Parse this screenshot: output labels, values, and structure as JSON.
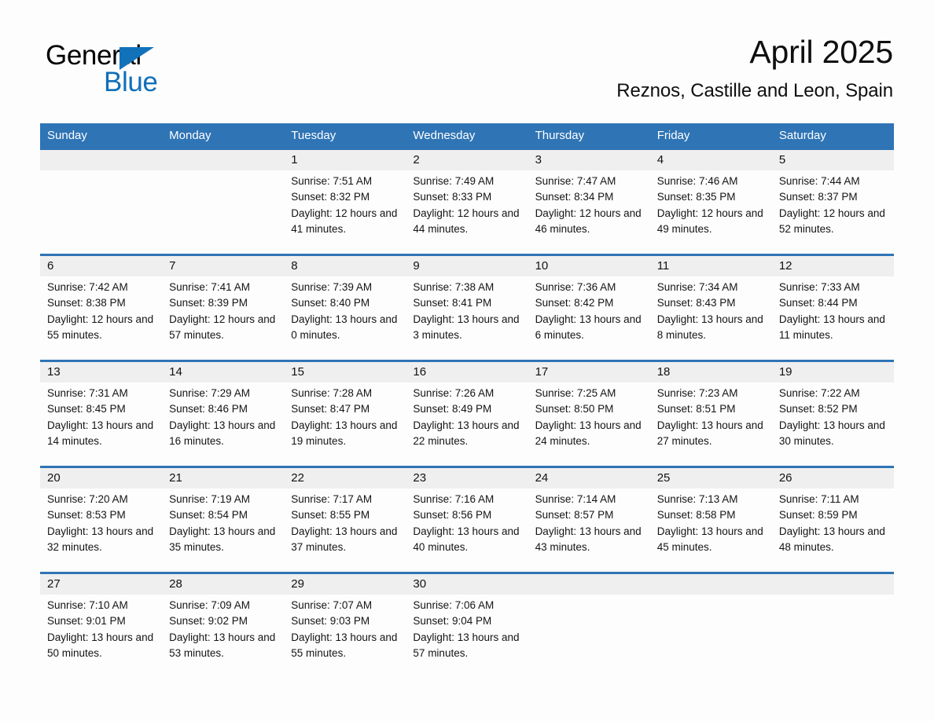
{
  "brand": {
    "word_one": "General",
    "word_two": "Blue",
    "triangle_icon": "triangle-icon",
    "accent_color": "#0f6fb8"
  },
  "header": {
    "month_title": "April 2025",
    "location": "Reznos, Castille and Leon, Spain"
  },
  "colors": {
    "header_blue": "#2f74b5",
    "date_band_gray": "#efefef",
    "page_background": "#fdfdfd",
    "text": "#141414"
  },
  "calendar": {
    "weekdays": [
      "Sunday",
      "Monday",
      "Tuesday",
      "Wednesday",
      "Thursday",
      "Friday",
      "Saturday"
    ],
    "weeks": [
      [
        {
          "day": "",
          "sunrise": "",
          "sunset": "",
          "daylight": ""
        },
        {
          "day": "",
          "sunrise": "",
          "sunset": "",
          "daylight": ""
        },
        {
          "day": "1",
          "sunrise": "Sunrise: 7:51 AM",
          "sunset": "Sunset: 8:32 PM",
          "daylight": "Daylight: 12 hours and 41 minutes."
        },
        {
          "day": "2",
          "sunrise": "Sunrise: 7:49 AM",
          "sunset": "Sunset: 8:33 PM",
          "daylight": "Daylight: 12 hours and 44 minutes."
        },
        {
          "day": "3",
          "sunrise": "Sunrise: 7:47 AM",
          "sunset": "Sunset: 8:34 PM",
          "daylight": "Daylight: 12 hours and 46 minutes."
        },
        {
          "day": "4",
          "sunrise": "Sunrise: 7:46 AM",
          "sunset": "Sunset: 8:35 PM",
          "daylight": "Daylight: 12 hours and 49 minutes."
        },
        {
          "day": "5",
          "sunrise": "Sunrise: 7:44 AM",
          "sunset": "Sunset: 8:37 PM",
          "daylight": "Daylight: 12 hours and 52 minutes."
        }
      ],
      [
        {
          "day": "6",
          "sunrise": "Sunrise: 7:42 AM",
          "sunset": "Sunset: 8:38 PM",
          "daylight": "Daylight: 12 hours and 55 minutes."
        },
        {
          "day": "7",
          "sunrise": "Sunrise: 7:41 AM",
          "sunset": "Sunset: 8:39 PM",
          "daylight": "Daylight: 12 hours and 57 minutes."
        },
        {
          "day": "8",
          "sunrise": "Sunrise: 7:39 AM",
          "sunset": "Sunset: 8:40 PM",
          "daylight": "Daylight: 13 hours and 0 minutes."
        },
        {
          "day": "9",
          "sunrise": "Sunrise: 7:38 AM",
          "sunset": "Sunset: 8:41 PM",
          "daylight": "Daylight: 13 hours and 3 minutes."
        },
        {
          "day": "10",
          "sunrise": "Sunrise: 7:36 AM",
          "sunset": "Sunset: 8:42 PM",
          "daylight": "Daylight: 13 hours and 6 minutes."
        },
        {
          "day": "11",
          "sunrise": "Sunrise: 7:34 AM",
          "sunset": "Sunset: 8:43 PM",
          "daylight": "Daylight: 13 hours and 8 minutes."
        },
        {
          "day": "12",
          "sunrise": "Sunrise: 7:33 AM",
          "sunset": "Sunset: 8:44 PM",
          "daylight": "Daylight: 13 hours and 11 minutes."
        }
      ],
      [
        {
          "day": "13",
          "sunrise": "Sunrise: 7:31 AM",
          "sunset": "Sunset: 8:45 PM",
          "daylight": "Daylight: 13 hours and 14 minutes."
        },
        {
          "day": "14",
          "sunrise": "Sunrise: 7:29 AM",
          "sunset": "Sunset: 8:46 PM",
          "daylight": "Daylight: 13 hours and 16 minutes."
        },
        {
          "day": "15",
          "sunrise": "Sunrise: 7:28 AM",
          "sunset": "Sunset: 8:47 PM",
          "daylight": "Daylight: 13 hours and 19 minutes."
        },
        {
          "day": "16",
          "sunrise": "Sunrise: 7:26 AM",
          "sunset": "Sunset: 8:49 PM",
          "daylight": "Daylight: 13 hours and 22 minutes."
        },
        {
          "day": "17",
          "sunrise": "Sunrise: 7:25 AM",
          "sunset": "Sunset: 8:50 PM",
          "daylight": "Daylight: 13 hours and 24 minutes."
        },
        {
          "day": "18",
          "sunrise": "Sunrise: 7:23 AM",
          "sunset": "Sunset: 8:51 PM",
          "daylight": "Daylight: 13 hours and 27 minutes."
        },
        {
          "day": "19",
          "sunrise": "Sunrise: 7:22 AM",
          "sunset": "Sunset: 8:52 PM",
          "daylight": "Daylight: 13 hours and 30 minutes."
        }
      ],
      [
        {
          "day": "20",
          "sunrise": "Sunrise: 7:20 AM",
          "sunset": "Sunset: 8:53 PM",
          "daylight": "Daylight: 13 hours and 32 minutes."
        },
        {
          "day": "21",
          "sunrise": "Sunrise: 7:19 AM",
          "sunset": "Sunset: 8:54 PM",
          "daylight": "Daylight: 13 hours and 35 minutes."
        },
        {
          "day": "22",
          "sunrise": "Sunrise: 7:17 AM",
          "sunset": "Sunset: 8:55 PM",
          "daylight": "Daylight: 13 hours and 37 minutes."
        },
        {
          "day": "23",
          "sunrise": "Sunrise: 7:16 AM",
          "sunset": "Sunset: 8:56 PM",
          "daylight": "Daylight: 13 hours and 40 minutes."
        },
        {
          "day": "24",
          "sunrise": "Sunrise: 7:14 AM",
          "sunset": "Sunset: 8:57 PM",
          "daylight": "Daylight: 13 hours and 43 minutes."
        },
        {
          "day": "25",
          "sunrise": "Sunrise: 7:13 AM",
          "sunset": "Sunset: 8:58 PM",
          "daylight": "Daylight: 13 hours and 45 minutes."
        },
        {
          "day": "26",
          "sunrise": "Sunrise: 7:11 AM",
          "sunset": "Sunset: 8:59 PM",
          "daylight": "Daylight: 13 hours and 48 minutes."
        }
      ],
      [
        {
          "day": "27",
          "sunrise": "Sunrise: 7:10 AM",
          "sunset": "Sunset: 9:01 PM",
          "daylight": "Daylight: 13 hours and 50 minutes."
        },
        {
          "day": "28",
          "sunrise": "Sunrise: 7:09 AM",
          "sunset": "Sunset: 9:02 PM",
          "daylight": "Daylight: 13 hours and 53 minutes."
        },
        {
          "day": "29",
          "sunrise": "Sunrise: 7:07 AM",
          "sunset": "Sunset: 9:03 PM",
          "daylight": "Daylight: 13 hours and 55 minutes."
        },
        {
          "day": "30",
          "sunrise": "Sunrise: 7:06 AM",
          "sunset": "Sunset: 9:04 PM",
          "daylight": "Daylight: 13 hours and 57 minutes."
        },
        {
          "day": "",
          "sunrise": "",
          "sunset": "",
          "daylight": ""
        },
        {
          "day": "",
          "sunrise": "",
          "sunset": "",
          "daylight": ""
        },
        {
          "day": "",
          "sunrise": "",
          "sunset": "",
          "daylight": ""
        }
      ]
    ]
  }
}
